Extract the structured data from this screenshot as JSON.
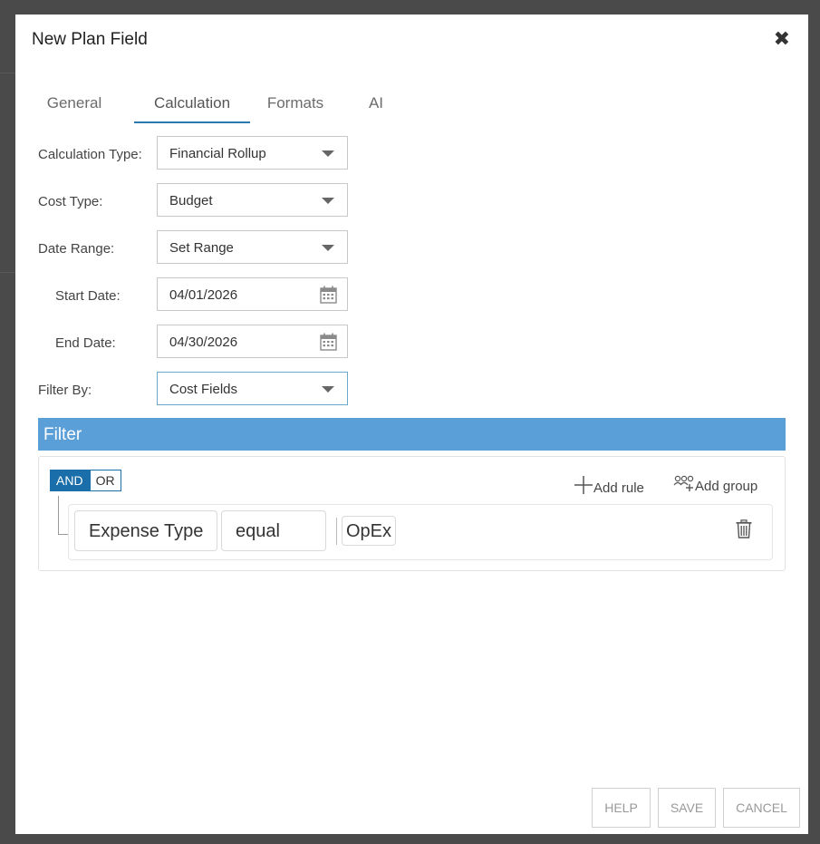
{
  "dialog": {
    "title": "New Plan Field",
    "close_icon": "close-icon"
  },
  "tabs": [
    {
      "label": "General",
      "active": false
    },
    {
      "label": "Calculation",
      "active": true
    },
    {
      "label": "Formats",
      "active": false
    },
    {
      "label": "AI",
      "active": false
    }
  ],
  "form": {
    "calculation_type": {
      "label": "Calculation Type:",
      "value": "Financial Rollup"
    },
    "cost_type": {
      "label": "Cost Type:",
      "value": "Budget"
    },
    "date_range": {
      "label": "Date Range:",
      "value": "Set Range"
    },
    "start_date": {
      "label": "Start Date:",
      "value": "04/01/2026"
    },
    "end_date": {
      "label": "End Date:",
      "value": "04/30/2026"
    },
    "filter_by": {
      "label": "Filter By:",
      "value": "Cost Fields"
    }
  },
  "filter": {
    "header": "Filter",
    "and_label": "AND",
    "or_label": "OR",
    "add_rule": "Add rule",
    "add_group": "Add group",
    "rule": {
      "field": "Expense Type",
      "operator": "equal",
      "value": "OpEx"
    }
  },
  "footer": {
    "help": "HELP",
    "save": "SAVE",
    "cancel": "CANCEL"
  },
  "colors": {
    "accent": "#1a6faa",
    "filter_header": "#5b9fd9",
    "tab_underline": "#2a7ab0"
  }
}
